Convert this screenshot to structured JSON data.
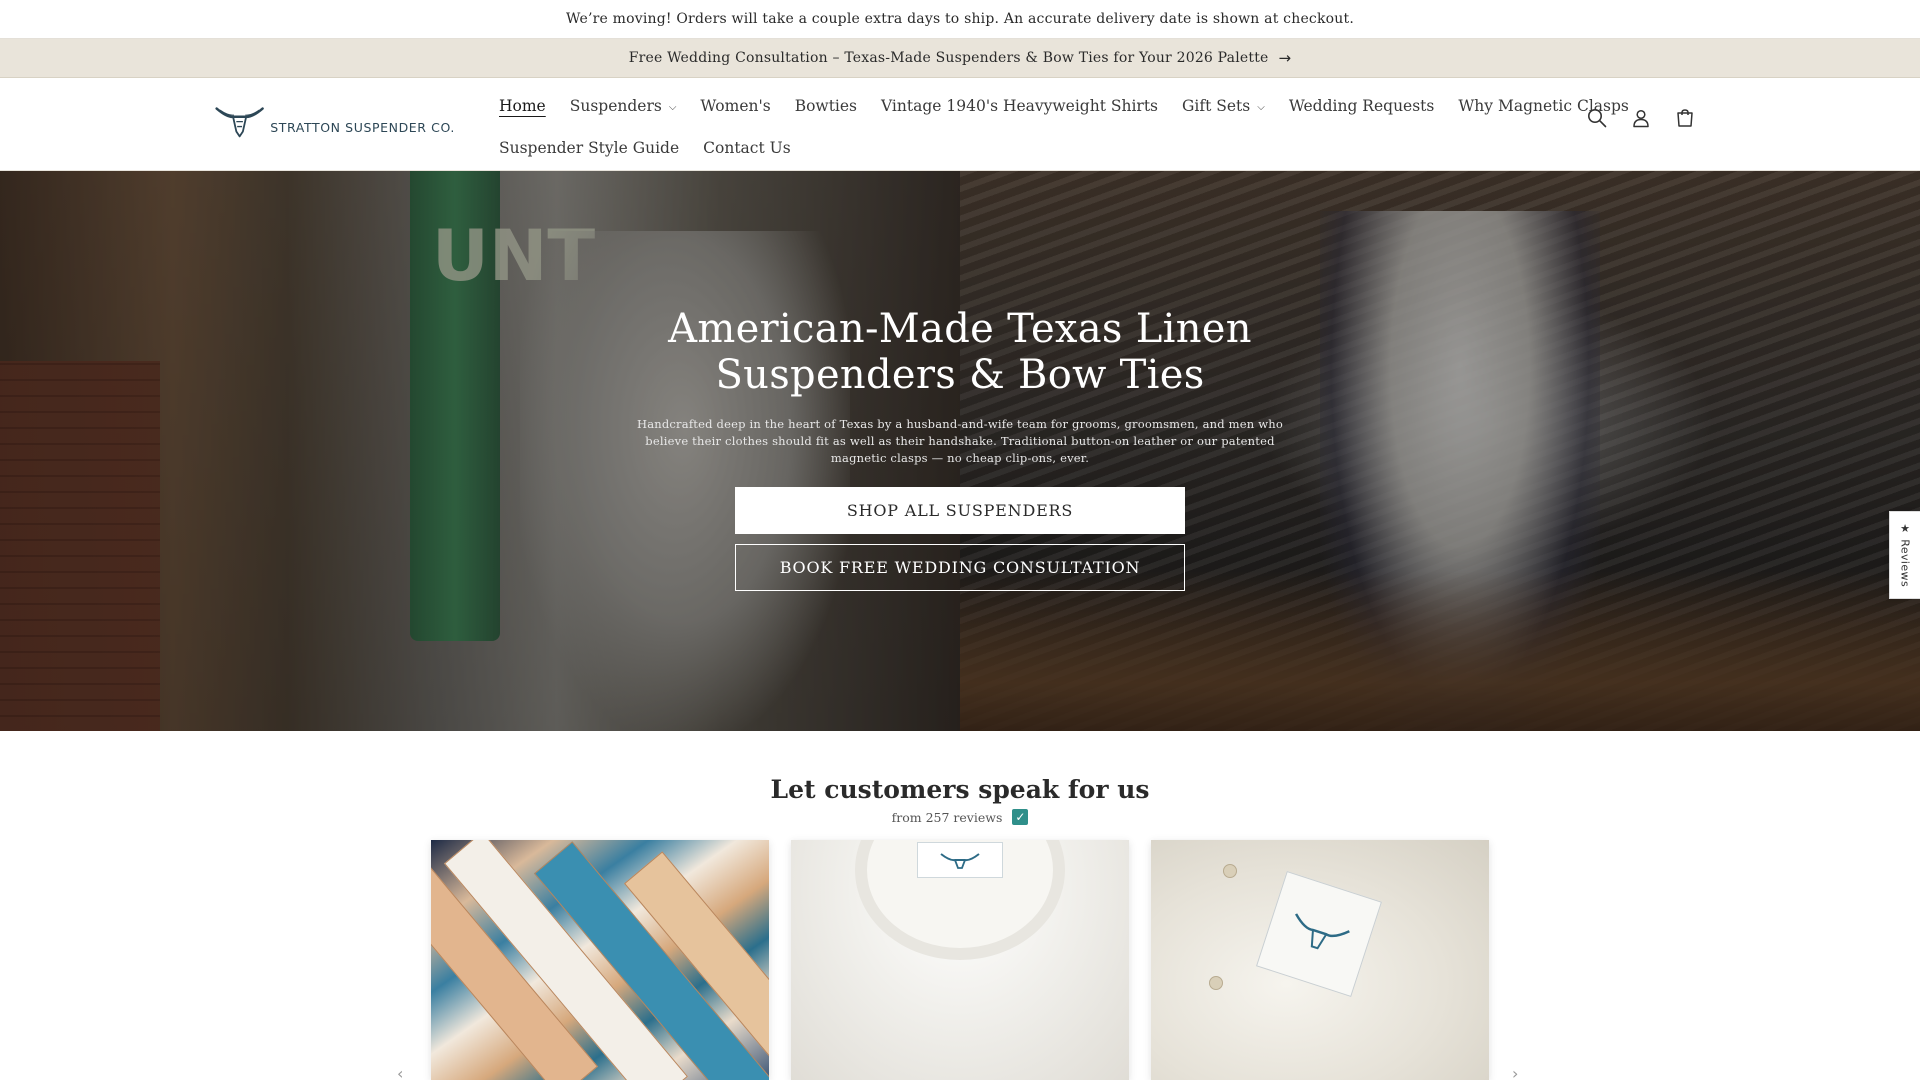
{
  "announcement": {
    "notice": "We’re moving! Orders will take a couple extra days to ship. An accurate delivery date is shown at checkout.",
    "promo": "Free Wedding Consultation – Texas-Made Suspenders & Bow Ties for Your 2026 Palette"
  },
  "brand": {
    "name": "STRATTON SUSPENDER CO.",
    "color": "#2d4756"
  },
  "nav": {
    "row1": [
      {
        "label": "Home",
        "active": true
      },
      {
        "label": "Suspenders",
        "dropdown": true
      },
      {
        "label": "Women's"
      },
      {
        "label": "Bowties"
      },
      {
        "label": "Vintage 1940's Heavyweight Shirts"
      },
      {
        "label": "Gift Sets",
        "dropdown": true
      },
      {
        "label": "Wedding Requests"
      },
      {
        "label": "Why Magnetic Clasps"
      }
    ],
    "row2": [
      {
        "label": "Suspender Style Guide"
      },
      {
        "label": "Contact Us"
      }
    ]
  },
  "header_icons": [
    "search-icon",
    "account-icon",
    "cart-icon"
  ],
  "hero": {
    "title": "American-Made Texas Linen Suspenders & Bow Ties",
    "description": "Handcrafted deep in the heart of Texas by a husband-and-wife team for grooms, groomsmen, and men who believe their clothes should fit as well as their handshake. Traditional button-on leather or our patented magnetic clasps — no cheap clip-ons, ever.",
    "primary_button": "SHOP ALL SUSPENDERS",
    "secondary_button": "BOOK FREE WEDDING CONSULTATION",
    "sign_letters": "UNT"
  },
  "reviews_tab": {
    "label": "★ Reviews"
  },
  "reviews": {
    "title": "Let customers speak for us",
    "subtitle": "from 257 reviews",
    "verified_color": "#2f8f8a"
  }
}
